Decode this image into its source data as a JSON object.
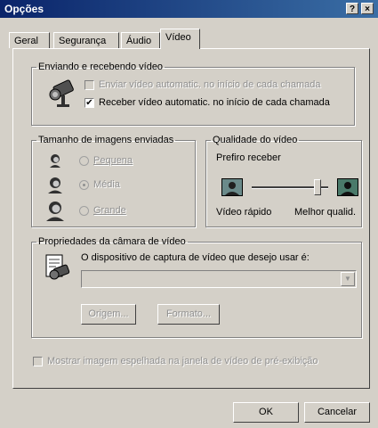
{
  "window": {
    "title": "Opções",
    "help_glyph": "?",
    "close_glyph": "×"
  },
  "tabs": [
    {
      "label": "Geral"
    },
    {
      "label": "Segurança"
    },
    {
      "label": "Áudio"
    },
    {
      "label": "Vídeo",
      "active": true
    }
  ],
  "sending": {
    "legend": "Enviando e recebendo vídeo",
    "send_auto": {
      "label": "Enviar vídeo automatic. no início de cada chamada",
      "checked": false,
      "enabled": false
    },
    "receive_auto": {
      "label": "Receber vídeo automatic. no início de cada chamada",
      "checked": true,
      "enabled": true,
      "check_glyph": "✔"
    }
  },
  "image_size": {
    "legend": "Tamanho de imagens enviadas",
    "options": [
      {
        "label": "Pequena",
        "checked": false
      },
      {
        "label": "Média",
        "checked": true
      },
      {
        "label": "Grande",
        "checked": false
      }
    ]
  },
  "quality": {
    "legend": "Qualidade do vídeo",
    "prefer_label": "Prefiro receber",
    "left_label": "Vídeo rápido",
    "right_label": "Melhor qualid.",
    "slider_level": 0.9
  },
  "camera": {
    "legend": "Propriedades da câmara de vídeo",
    "device_label": "O dispositivo de captura de vídeo que desejo usar é:",
    "device_value": "",
    "source_button": "Origem...",
    "format_button": "Formato..."
  },
  "mirror": {
    "label": "Mostrar imagem espelhada na janela de vídeo de pré-exibição",
    "checked": false,
    "enabled": false
  },
  "buttons": {
    "ok": "OK",
    "cancel": "Cancelar"
  },
  "icons": {
    "camera": "video-camera-icon",
    "face": "person-face-icon",
    "camera_doc": "camera-properties-icon"
  }
}
